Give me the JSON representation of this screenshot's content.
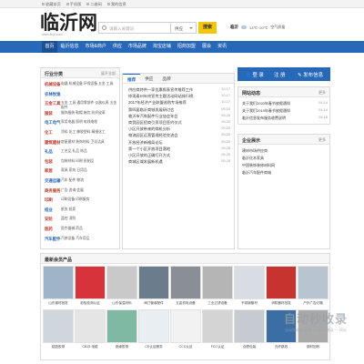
{
  "topbar": {
    "items": [
      "收藏本页",
      "手机版",
      "二维码",
      "我的信息"
    ]
  },
  "header": {
    "logo": "临沂网",
    "logo_sub": "www.linyi.com",
    "search_placeholder": "请输入关键词",
    "search_scope": "供应",
    "search_button": "搜索",
    "weather": {
      "city": "临沂",
      "temp": "13℃~20℃",
      "aqi": "空气质量"
    }
  },
  "nav": {
    "items": [
      "首页",
      "临沂信息",
      "市场&商户",
      "供应",
      "市场品牌",
      "淘宝店铺",
      "招商加盟",
      "展会",
      "资讯"
    ]
  },
  "categories": {
    "title": "行业分类",
    "more": "展开全部",
    "rows": [
      {
        "name": "机械设备",
        "subs": "电器  机械设备  环保设备  五金  工具"
      },
      {
        "name": "农林牧渔",
        "subs": ""
      },
      {
        "name": "五金工具",
        "subs": "五金  工具  通用零部件  仪器仪表  五金配件"
      },
      {
        "name": "服装",
        "subs": "服饰服装  鞋帽  箱包  纺织皮革"
      },
      {
        "name": "电工电气",
        "subs": "家用电器  照明  电线电缆"
      },
      {
        "name": "化工",
        "subs": "涂料  化工  橡胶塑料  精细化工"
      },
      {
        "name": "建筑建材",
        "subs": "房屋建材  装饰材料  卫浴洁具"
      },
      {
        "name": "礼品",
        "subs": "工艺品  礼品  饰品"
      },
      {
        "name": "包装",
        "subs": "包装材料  印刷  纸制品"
      },
      {
        "name": "家居",
        "subs": "家具  家纺  日用品"
      },
      {
        "name": "交通运输",
        "subs": "汽车  配件  物流"
      },
      {
        "name": "商务服务",
        "subs": "广告  咨询  会展"
      },
      {
        "name": "印刷",
        "subs": "印刷设备  印刷服务"
      },
      {
        "name": "纸业",
        "subs": "纸张  纸浆"
      },
      {
        "name": "安防",
        "subs": "监控  消防"
      },
      {
        "name": "医药",
        "subs": "医疗器械  药品"
      },
      {
        "name": "汽车配件",
        "subs": "汽修设备  汽车用品"
      }
    ]
  },
  "news": {
    "tabs": [
      "推荐",
      "供应",
      "品牌"
    ],
    "items": [
      {
        "title": "供应商特供一家优惠报表宣传推荐工作",
        "date": "10-17"
      },
      {
        "title": "惊现泰州年终宣传主题活动网站排行榜",
        "date": "10-17"
      },
      {
        "title": "2017年经济产业联盟选购专场推荐",
        "date": "10-17"
      },
      {
        "title": "第四届临沂商城发展研讨会",
        "date": "09-15"
      },
      {
        "title": "临沂市汽车配件行业协会年会",
        "date": "09-25"
      },
      {
        "title": "商贸园区招商引资项目签约仪式",
        "date": "09-25"
      },
      {
        "title": "小区开放带来的商机分析",
        "date": "09-25"
      },
      {
        "title": "物流园区运营管理经验交流会",
        "date": "09-25"
      },
      {
        "title": "开放经济新格局论坛",
        "date": "09-25"
      },
      {
        "title": "第一个小区开放项目落地",
        "date": "09-25"
      },
      {
        "title": "小区开放的正确打开方式",
        "date": "09-25"
      },
      {
        "title": "商城区域发展新机遇",
        "date": "09-25"
      }
    ]
  },
  "right": {
    "login": "登 录",
    "register": "注 册",
    "publish": "发布信息",
    "notice_title": "网站动态",
    "notice_more": "更多",
    "notices": [
      {
        "title": "关于我们2020年春节放假通知",
        "date": "01-14"
      },
      {
        "title": "关于我们2019年春节放假通知",
        "date": "01-14"
      },
      {
        "title": "临沂信息发布服务收费说明",
        "date": "03-18"
      }
    ],
    "company_title": "企业展示",
    "company_more": "更多",
    "companies": [
      "建材市场供应商",
      "临沂红木家具",
      "中国装饰装修材料网",
      "临沂汽车配件商城"
    ]
  },
  "products": {
    "title": "最新会员产品",
    "row1": [
      "山东钢材批发",
      "检验检测认证",
      "山东保温材料",
      "阀门管道配件",
      "五金机电设备",
      "工业过滤设备",
      "不锈钢管材",
      "消防器材批发",
      "户外广告灯箱"
    ],
    "row2": [
      "铝箔胶带",
      "CB15 电缆",
      "绝缘胶带",
      "CE认证服务",
      "CCC认证",
      "FCC认证",
      "合肥包装",
      "光纤跳线",
      "钢材回收"
    ]
  },
  "watermark": {
    "main": "自动秒收录",
    "sub": "自动秒收录  免费  一  次  一  收录  一  网站"
  },
  "colors": {
    "accent": "#2868b8",
    "button": "#f1c60b",
    "category": "#c0392b"
  }
}
